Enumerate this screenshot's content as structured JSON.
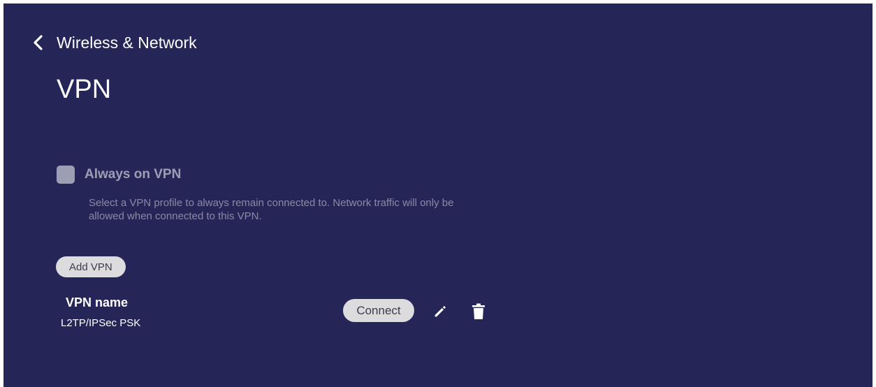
{
  "header": {
    "back_icon": "chevron-left-icon",
    "title": "Wireless & Network"
  },
  "page": {
    "title": "VPN"
  },
  "always_on": {
    "label": "Always on VPN",
    "checked": false,
    "description": "Select a VPN profile to always remain connected to. Network traffic will only be allowed when connected to this VPN."
  },
  "actions": {
    "add_vpn_label": "Add VPN"
  },
  "vpn_list": [
    {
      "name": "VPN name",
      "type": "L2TP/IPSec PSK",
      "connect_label": "Connect",
      "edit_icon": "pencil-icon",
      "delete_icon": "trash-icon"
    }
  ],
  "colors": {
    "background": "#262558",
    "text": "#ffffff",
    "button_bg": "#dcdcdf",
    "button_text": "#3c3c4a"
  }
}
